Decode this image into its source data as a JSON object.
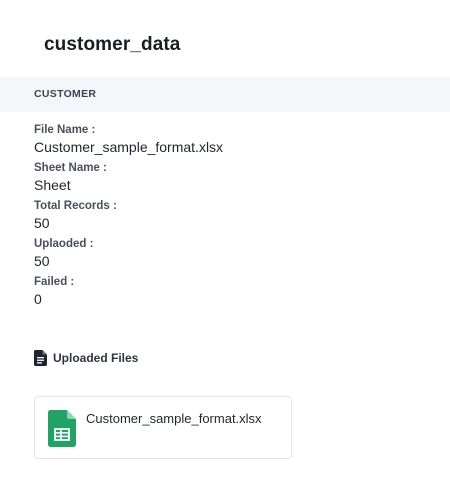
{
  "page": {
    "title": "customer_data"
  },
  "section": {
    "header": "CUSTOMER"
  },
  "info": {
    "fields": [
      {
        "label": "File Name :",
        "value": "Customer_sample_format.xlsx"
      },
      {
        "label": "Sheet Name :",
        "value": "Sheet"
      },
      {
        "label": "Total Records :",
        "value": "50"
      },
      {
        "label": "Uplaoded :",
        "value": "50"
      },
      {
        "label": "Failed :",
        "value": "0"
      }
    ]
  },
  "uploaded_files": {
    "label": "Uploaded Files",
    "icon": "document-icon",
    "files": [
      {
        "name": "Customer_sample_format.xlsx",
        "icon": "spreadsheet-icon",
        "color": "#21a366"
      }
    ]
  }
}
